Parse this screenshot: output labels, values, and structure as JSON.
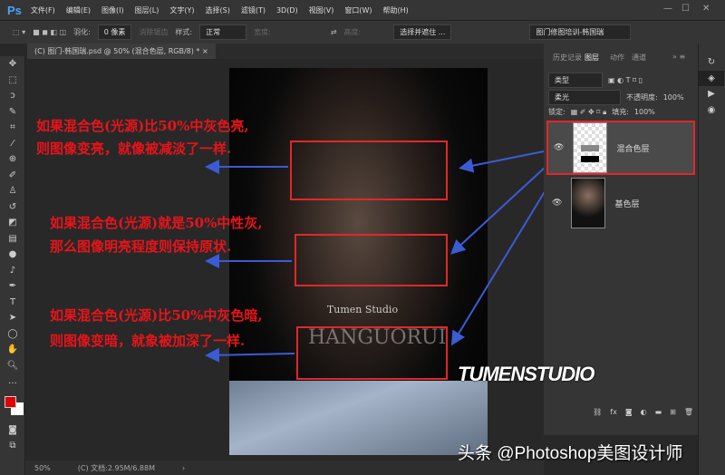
{
  "app": {
    "logo": "Ps",
    "menus": [
      "文件(F)",
      "编辑(E)",
      "图像(I)",
      "图层(L)",
      "文字(Y)",
      "选择(S)",
      "滤镜(T)",
      "3D(D)",
      "视图(V)",
      "窗口(W)",
      "帮助(H)"
    ]
  },
  "options": {
    "feather_label": "羽化:",
    "feather_value": "0 像素",
    "antialias": "消除锯齿",
    "style_label": "样式:",
    "style_value": "正常",
    "width_label": "宽度:",
    "height_label": "高度:",
    "select_mask": "选择并遮住 ...",
    "workspace": "图门修图培训-韩国瑞"
  },
  "document": {
    "tab": "(C) 图门-韩国瑞.psd @ 50% (混合色层, RGB/8) *",
    "zoom": "50%",
    "docsize": "(C) 文档:2.95M/6.88M",
    "photo_title": "Tumen Studio",
    "photo_brand": "HANGUORUI"
  },
  "panel": {
    "tabs": [
      "历史记录",
      "图层",
      "动作",
      "通道"
    ],
    "filter": "类型",
    "blend_mode": "柔光",
    "opacity_label": "不透明度:",
    "opacity": "100%",
    "lock_label": "锁定:",
    "fill_label": "填充:",
    "fill": "100%",
    "layers": [
      {
        "name": "混合色层",
        "selected": true
      },
      {
        "name": "基色层",
        "selected": false
      }
    ]
  },
  "annotations": [
    {
      "line1": "如果混合色(光源)比50%中灰色亮,",
      "line2": "则图像变亮，就像被减淡了一样."
    },
    {
      "line1": "如果混合色(光源)就是50%中性灰,",
      "line2": "那么图像明亮程度则保持原状."
    },
    {
      "line1": "如果混合色(光源)比50%中灰色暗,",
      "line2": "则图像变暗，就象被加深了一样."
    }
  ],
  "overlay": {
    "brand": "TUMENSTUDIO",
    "watermark": "头条 @Photoshop美图设计师"
  },
  "colors": {
    "annotation": "#e8141a",
    "arrow": "#3b5bd6",
    "foreground": "#e00000",
    "background": "#ffffff"
  }
}
